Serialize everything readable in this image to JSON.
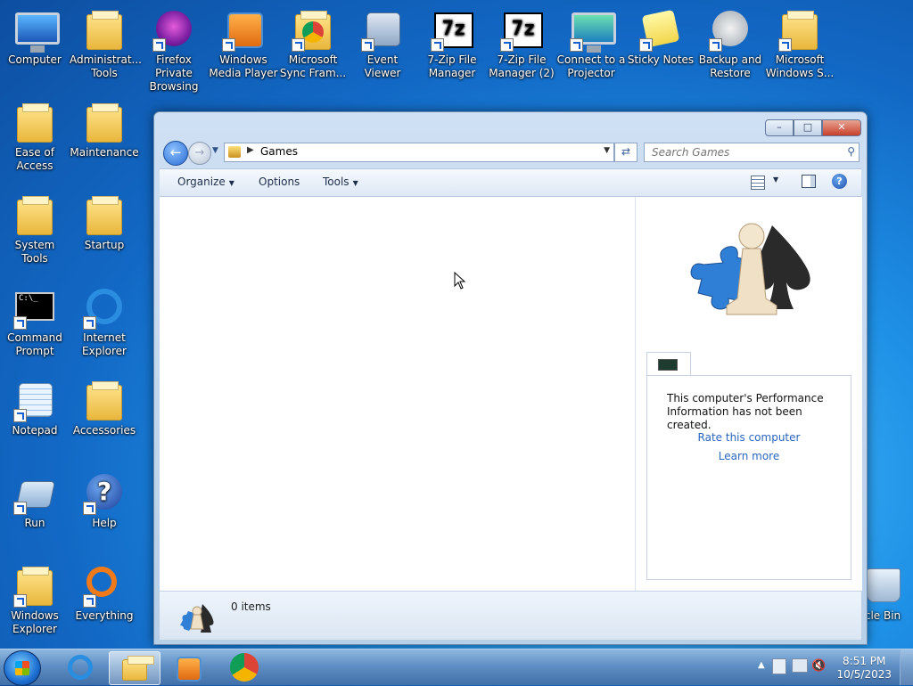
{
  "desktop": {
    "icons": [
      {
        "label": "Computer"
      },
      {
        "label": "Administrat... Tools"
      },
      {
        "label": "Firefox Private Browsing"
      },
      {
        "label": "Windows Media Player"
      },
      {
        "label": "Microsoft Sync Fram..."
      },
      {
        "label": "Event Viewer"
      },
      {
        "label": "7-Zip File Manager"
      },
      {
        "label": "7-Zip File Manager (2)"
      },
      {
        "label": "Connect to a Projector"
      },
      {
        "label": "Sticky Notes"
      },
      {
        "label": "Backup and Restore"
      },
      {
        "label": "Microsoft Windows S..."
      },
      {
        "label": "Ease of Access"
      },
      {
        "label": "Maintenance"
      },
      {
        "label": "System Tools"
      },
      {
        "label": "Startup"
      },
      {
        "label": "Command Prompt"
      },
      {
        "label": "Internet Explorer"
      },
      {
        "label": "Notepad"
      },
      {
        "label": "Accessories"
      },
      {
        "label": "Run"
      },
      {
        "label": "Help"
      },
      {
        "label": "Windows Explorer"
      },
      {
        "label": "Everything"
      },
      {
        "label": "cle Bin"
      }
    ]
  },
  "window": {
    "controls": {
      "minimize": "–",
      "maximize": "□",
      "close": "✕"
    },
    "address": {
      "crumb": "Games"
    },
    "search": {
      "placeholder": "Search Games"
    },
    "toolbar": {
      "organize": "Organize",
      "options": "Options",
      "tools": "Tools"
    },
    "details": {
      "message": "This computer's Performance Information has not been created.",
      "rate_link": "Rate this computer",
      "learn_link": "Learn more"
    },
    "status": {
      "items": "0 items"
    }
  },
  "taskbar": {
    "clock_time": "8:51 PM",
    "clock_date": "10/5/2023"
  },
  "colors": {
    "accent": "#2a66c0",
    "taskbar": "#5f8fc4"
  }
}
